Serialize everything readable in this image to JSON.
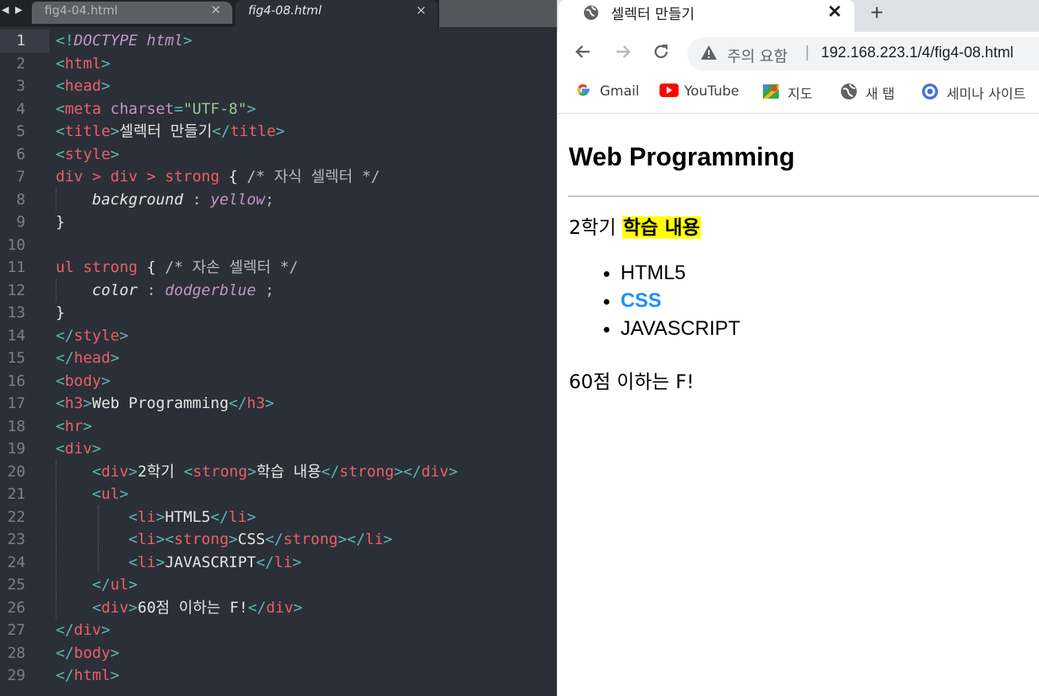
{
  "editor": {
    "nav_arrows": "◀ ▶",
    "tabs": [
      {
        "label": "fig4-04.html",
        "active": false
      },
      {
        "label": "fig4-08.html",
        "active": true
      }
    ],
    "tab_close_glyph": "×",
    "current_line": 1,
    "line_numbers": [
      "1",
      "2",
      "3",
      "4",
      "5",
      "6",
      "7",
      "8",
      "9",
      "10",
      "11",
      "12",
      "13",
      "14",
      "15",
      "16",
      "17",
      "18",
      "19",
      "20",
      "21",
      "22",
      "23",
      "24",
      "25",
      "26",
      "27",
      "28",
      "29"
    ],
    "code": {
      "doctype": "DOCTYPE html",
      "html": "html",
      "head": "head",
      "meta": "meta",
      "charset_attr": "charset",
      "charset_val": "\"UTF-8\"",
      "title": "title",
      "title_text": "셀렉터 만들기",
      "style": "style",
      "sel1": "div > div > strong",
      "com1": "/* 자식 셀렉터 */",
      "prop1": "background",
      "val1": "yellow",
      "sel2": "ul strong",
      "com2": "/* 자손 셀렉터 */",
      "prop2": "color",
      "val2": "dodgerblue",
      "body": "body",
      "h3": "h3",
      "h3_text": "Web Programming",
      "hr": "hr",
      "div": "div",
      "div_text": "2학기 ",
      "strong": "strong",
      "strong_text": "학습 내용",
      "ul": "ul",
      "li": "li",
      "li1": "HTML5",
      "li2": "CSS",
      "li3": "JAVASCRIPT",
      "last_div_text": "60점 이하는 F!"
    }
  },
  "browser": {
    "tab_title": "셀렉터 만들기",
    "tab_close": "✕",
    "new_tab": "+",
    "security_label": "주의 요함",
    "url": "192.168.223.1/4/fig4-08.html",
    "bookmarks": [
      {
        "label": "Gmail",
        "icon": "google-icon"
      },
      {
        "label": "YouTube",
        "icon": "youtube-icon"
      },
      {
        "label": "지도",
        "icon": "maps-icon"
      },
      {
        "label": "새 탭",
        "icon": "globe-icon"
      },
      {
        "label": "세미나 사이트",
        "icon": "seminar-icon"
      }
    ],
    "page": {
      "heading": "Web Programming",
      "semester_prefix": "2학기 ",
      "semester_strong": "학습 내용",
      "list": [
        "HTML5",
        "CSS",
        "JAVASCRIPT"
      ],
      "grade_line": "60점 이하는 F!"
    },
    "colors": {
      "highlight": "#ffff00",
      "css_item": "#1e90ff"
    }
  }
}
